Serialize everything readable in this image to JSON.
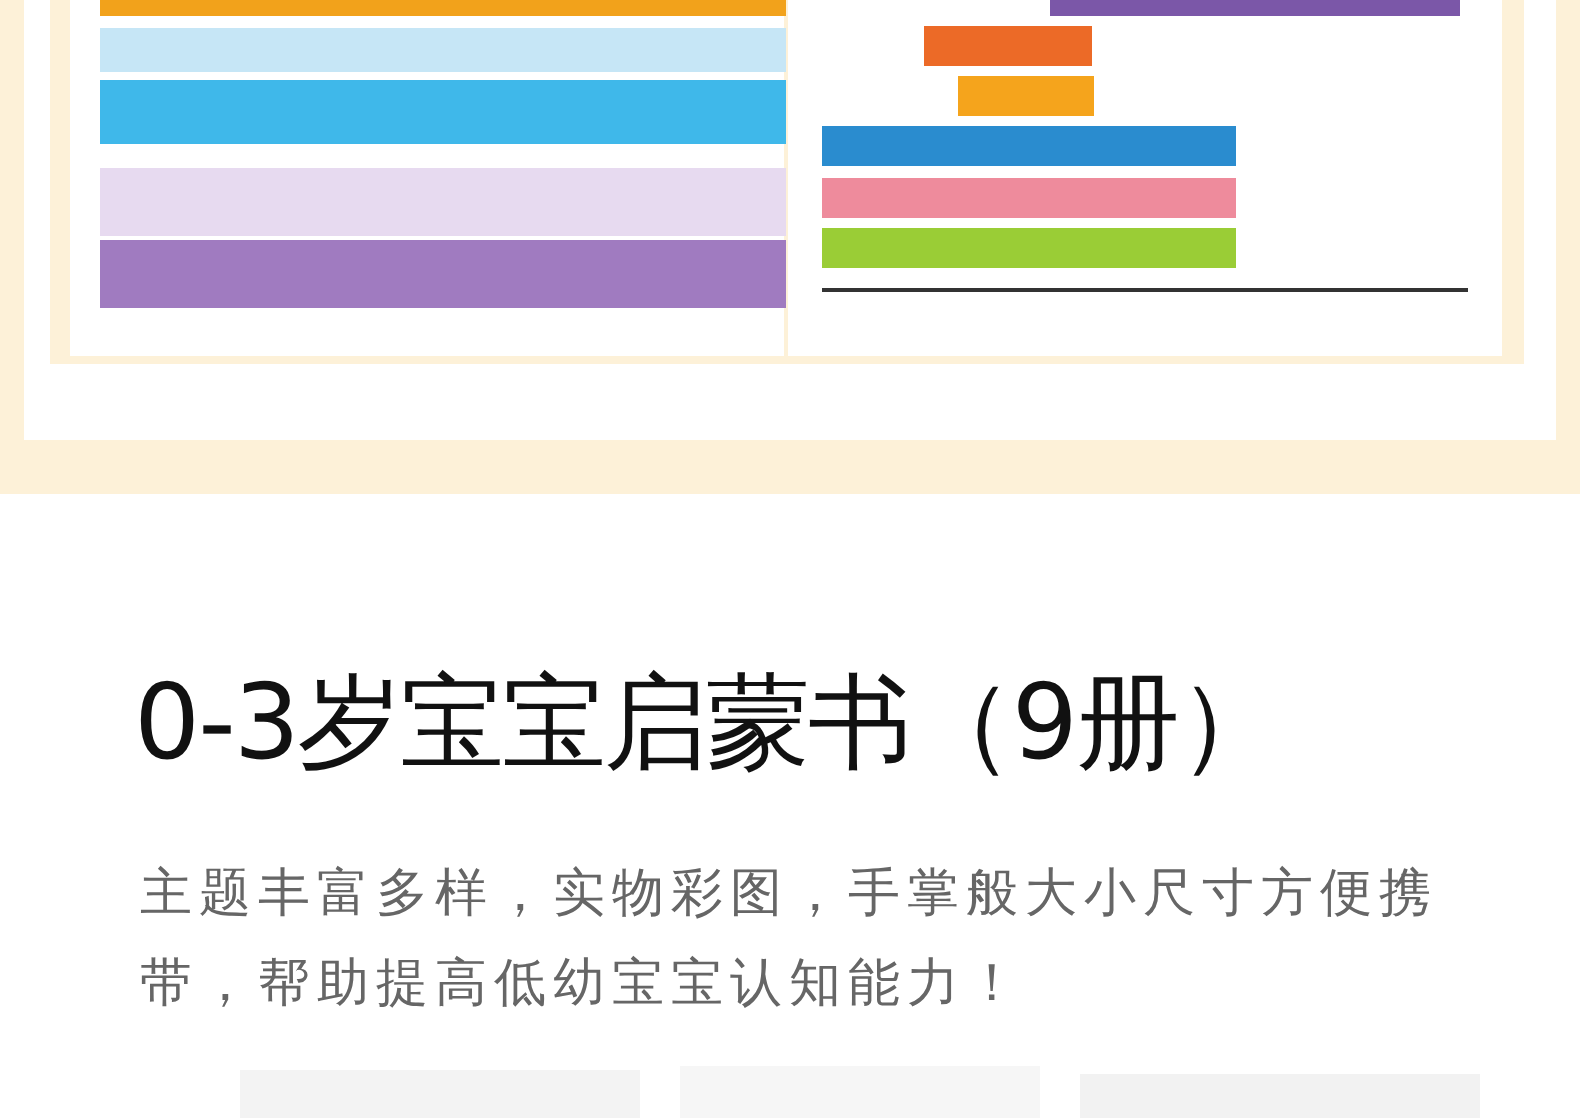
{
  "title": "0-3岁宝宝启蒙书（9册）",
  "description": "主题丰富多样，实物彩图，手掌般大小尺寸方便携带，帮助提高低幼宝宝认知能力！"
}
